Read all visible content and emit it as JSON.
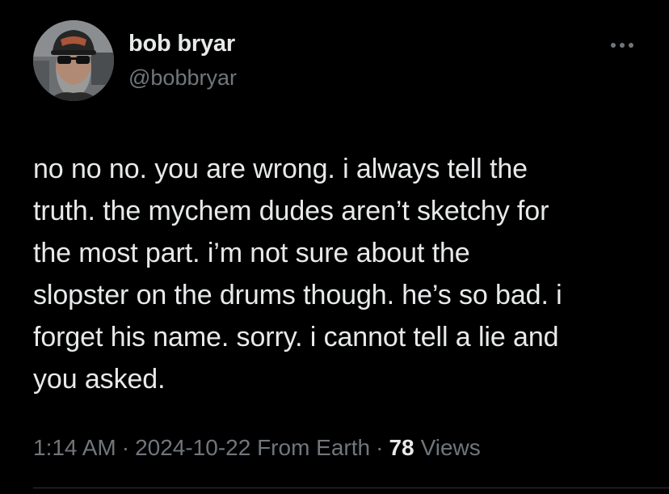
{
  "author": {
    "display_name": "bob bryar",
    "handle": "@bobbryar",
    "avatar_icon": "profile-photo"
  },
  "tweet": {
    "text": "no no no. you are wrong. i always tell the\ntruth. the mychem dudes aren’t sketchy for\nthe most part. i’m not sure about the\nslopster on the drums though. he’s so bad. i\nforget his name. sorry. i cannot tell a lie and\nyou asked."
  },
  "meta": {
    "time": "1:14 AM",
    "separator": "·",
    "date_source": "2024-10-22 From Earth",
    "views_count": "78",
    "views_label": "Views"
  },
  "icons": {
    "more": "more-horizontal-icon"
  },
  "colors": {
    "background": "#000000",
    "primary_text": "#e7e9ea",
    "secondary_text": "#71767b",
    "divider": "#2f3336"
  }
}
